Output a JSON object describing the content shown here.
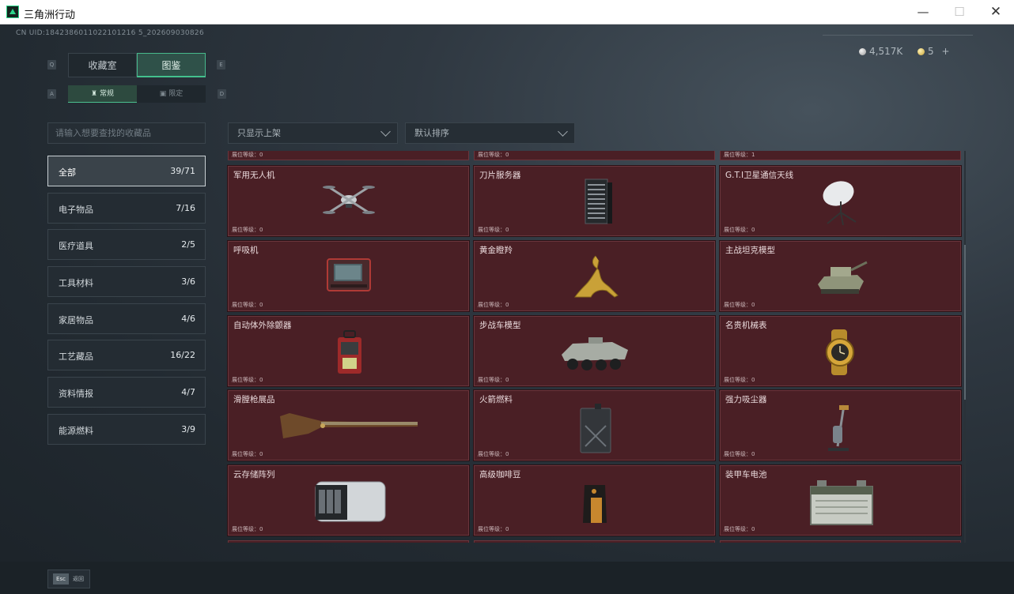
{
  "window": {
    "title": "三角洲行动"
  },
  "uid": "CN UID:1842386011022101216 5_202609030826",
  "currency": {
    "silver": "4,517K",
    "gold": "5",
    "add": "+"
  },
  "tabs": [
    {
      "label": "收藏室",
      "key": "Q"
    },
    {
      "label": "图鉴",
      "key": "E"
    }
  ],
  "subtabs": [
    {
      "label": "常规",
      "key": "A"
    },
    {
      "label": "限定",
      "key": "D"
    }
  ],
  "search": {
    "placeholder": "请输入想要查找的收藏品"
  },
  "categories": [
    {
      "label": "全部",
      "count": "39/71"
    },
    {
      "label": "电子物品",
      "count": "7/16"
    },
    {
      "label": "医疗道具",
      "count": "2/5"
    },
    {
      "label": "工具材料",
      "count": "3/6"
    },
    {
      "label": "家居物品",
      "count": "4/6"
    },
    {
      "label": "工艺藏品",
      "count": "16/22"
    },
    {
      "label": "资料情报",
      "count": "4/7"
    },
    {
      "label": "能源燃料",
      "count": "3/9"
    }
  ],
  "filters": {
    "shelf": "只显示上架",
    "sort": "默认排序"
  },
  "partial_levels": [
    "展位等级：0",
    "展位等级：0",
    "展位等级：1"
  ],
  "items": [
    {
      "name": "军用无人机",
      "level": "展位等级：0",
      "icon": "drone-icon"
    },
    {
      "name": "刀片服务器",
      "level": "展位等级：0",
      "icon": "server-icon"
    },
    {
      "name": "G.T.I卫星通信天线",
      "level": "展位等级：0",
      "icon": "satellite-dish-icon"
    },
    {
      "name": "呼吸机",
      "level": "展位等级：0",
      "icon": "ventilator-icon"
    },
    {
      "name": "黄金瞪羚",
      "level": "展位等级：0",
      "icon": "golden-gazelle-icon"
    },
    {
      "name": "主战坦克模型",
      "level": "展位等级：0",
      "icon": "tank-model-icon"
    },
    {
      "name": "自动体外除颤器",
      "level": "展位等级：0",
      "icon": "defibrillator-icon"
    },
    {
      "name": "步战车模型",
      "level": "展位等级：0",
      "icon": "ifv-model-icon"
    },
    {
      "name": "名贵机械表",
      "level": "展位等级：0",
      "icon": "watch-icon"
    },
    {
      "name": "滑膛枪展品",
      "level": "展位等级：0",
      "icon": "musket-icon"
    },
    {
      "name": "火箭燃料",
      "level": "展位等级：0",
      "icon": "fuel-canister-icon"
    },
    {
      "name": "强力吸尘器",
      "level": "展位等级：0",
      "icon": "vacuum-cleaner-icon"
    },
    {
      "name": "云存储阵列",
      "level": "展位等级：0",
      "icon": "storage-array-icon"
    },
    {
      "name": "高级咖啡豆",
      "level": "展位等级：0",
      "icon": "coffee-bag-icon"
    },
    {
      "name": "装甲车电池",
      "level": "展位等级：0",
      "icon": "battery-icon"
    }
  ],
  "back": {
    "key": "Esc",
    "label": "返回"
  }
}
